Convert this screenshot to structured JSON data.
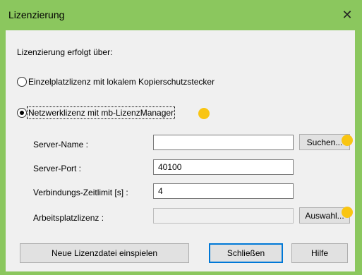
{
  "window": {
    "title": "Lizenzierung",
    "close_icon": "close-icon",
    "accent_color": "#8bc75e"
  },
  "intro_label": "Lizenzierung erfolgt über:",
  "license_options": [
    {
      "label": "Einzelplatzlizenz mit lokalem Kopierschutzstecker",
      "selected": false
    },
    {
      "label": "Netzwerklizenz mit mb-LizenzManager",
      "selected": true
    }
  ],
  "fields": {
    "server_name": {
      "label": "Server-Name :",
      "value": ""
    },
    "server_port": {
      "label": "Server-Port :",
      "value": "40100"
    },
    "timeout": {
      "label": "Verbindungs-Zeitlimit [s] :",
      "value": "4"
    },
    "workstation_license": {
      "label": "Arbeitsplatzlizenz :",
      "value": ""
    }
  },
  "buttons": {
    "search": "Suchen...",
    "select": "Auswahl...",
    "import_license": "Neue Lizenzdatei einspielen",
    "close": "Schließen",
    "help": "Hilfe"
  },
  "highlight_color": "#f9c512"
}
